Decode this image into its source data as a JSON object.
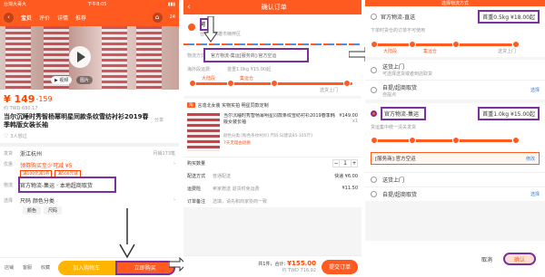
{
  "panel1": {
    "status_left": "台灣大哥大",
    "status_time": "下午8:05",
    "tabs": [
      "宝贝",
      "评价",
      "详情",
      "推荐"
    ],
    "cart_count": "24",
    "video_label": "▶ 视频",
    "image_label": "图片",
    "price": "¥ 149",
    "price_range": "-159",
    "twd": "约 TWD 680.17",
    "title": "当尔沉睡时秀智杨幂明星同款条纹雪纺衬衫2019春季韩版女装长袖",
    "share": "分享",
    "buyers": "3人想过",
    "shipping_label": "发货",
    "shipping_value": "浙江杭州",
    "monthly_sales": "月销173笔",
    "coupon_label": "优惠",
    "coupon_value": "领券购买至少可减 ¥5",
    "coupon_tags": [
      "满100元减5券",
      "满500元减"
    ],
    "logistics_label": "物流",
    "logistics_value": "官方物流-集运 · 本地超商取货",
    "select_label": "选择",
    "select_value": "尺码 颜色分类",
    "chips": [
      "颜色",
      "尺码"
    ],
    "bottom_icons": [
      "店铺",
      "客服",
      "收藏"
    ],
    "add_cart": "加入购物车",
    "buy_now": "立即购买"
  },
  "panel2": {
    "header_title": "确认订单",
    "address_name": "阿",
    "address_detail": "台湾省高雄市楠梓区",
    "logistics_label": "物流方式",
    "logistics_value": "官方物流-集运[服务商]:官方空运",
    "region_label": "海外段运费:",
    "region_value": "首重1.0kg ¥15.00起",
    "route_left": "大陆段",
    "route_mid": "集运仓",
    "route_right": "送货上门",
    "seller_tag": "淘",
    "seller_name": "言達北女装 实物实拍 明星同款定制",
    "item_title": "当尔沉睡时秀智杨幂明星同款条纹雪纺衬衫2019春季韩版女装长袖",
    "item_variant": "颜色分类:[粉色条纹衬衫] 尺码:S[建议85-105斤]",
    "item_price": "¥149.00",
    "item_qty": "x1",
    "item_note": "7天无理由退换",
    "qty_label": "购买数量",
    "qty_value": "1",
    "ship_label": "配送方式",
    "ship_value": "普通配送",
    "ship_fee": "快递 ¥6.00",
    "invoice_label": "运费险",
    "invoice_value": "卖家赠送 退货时免运费",
    "invoice_price": "¥11.50",
    "memo_label": "订单备注",
    "memo_placeholder": "选填，请先和商家协商一致",
    "total_prefix": "共1件，合计:",
    "total_value": "¥155.00",
    "total_twd": "约 TWD 716.92",
    "submit": "提交订单"
  },
  "panel3": {
    "header_title": "选择物流方式",
    "option1_name": "官方物流-直送",
    "option1_price": "首重0.5kg ¥18.00起",
    "option1_note": "下单时货仓的订单不可使用",
    "route_left": "大陆段",
    "route_mid": "集运仓",
    "route_right": "送货上门",
    "delivery_label": "送货上门",
    "delivery_note": "可选择送货或者到店取货",
    "pickup_label": "自提/超商取货",
    "pickup_note": "自提点",
    "pickup_action": "选择",
    "option2_name": "官方物流-集运",
    "option2_price": "首重1.0kg ¥15.00起",
    "option2_note": "货运集中统一清关发货",
    "service_label": "[服务商]:官方空运",
    "service_action": "修改",
    "delivery2_label": "送货上门",
    "pickup2_label": "自提/超商取货",
    "pickup2_action": "选择",
    "cancel": "取消",
    "confirm": "确认"
  },
  "colors": {
    "brand": "#ff5a1f",
    "highlight": "#7b2fa0",
    "price": "#ff4400"
  }
}
